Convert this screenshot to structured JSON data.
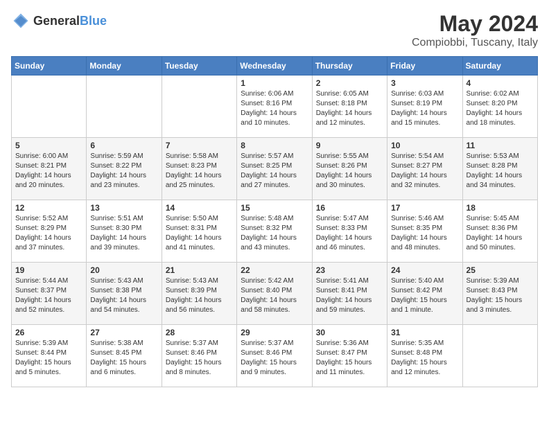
{
  "header": {
    "logo_general": "General",
    "logo_blue": "Blue",
    "month": "May 2024",
    "location": "Compiobbi, Tuscany, Italy"
  },
  "weekdays": [
    "Sunday",
    "Monday",
    "Tuesday",
    "Wednesday",
    "Thursday",
    "Friday",
    "Saturday"
  ],
  "weeks": [
    [
      {
        "day": "",
        "content": ""
      },
      {
        "day": "",
        "content": ""
      },
      {
        "day": "",
        "content": ""
      },
      {
        "day": "1",
        "content": "Sunrise: 6:06 AM\nSunset: 8:16 PM\nDaylight: 14 hours\nand 10 minutes."
      },
      {
        "day": "2",
        "content": "Sunrise: 6:05 AM\nSunset: 8:18 PM\nDaylight: 14 hours\nand 12 minutes."
      },
      {
        "day": "3",
        "content": "Sunrise: 6:03 AM\nSunset: 8:19 PM\nDaylight: 14 hours\nand 15 minutes."
      },
      {
        "day": "4",
        "content": "Sunrise: 6:02 AM\nSunset: 8:20 PM\nDaylight: 14 hours\nand 18 minutes."
      }
    ],
    [
      {
        "day": "5",
        "content": "Sunrise: 6:00 AM\nSunset: 8:21 PM\nDaylight: 14 hours\nand 20 minutes."
      },
      {
        "day": "6",
        "content": "Sunrise: 5:59 AM\nSunset: 8:22 PM\nDaylight: 14 hours\nand 23 minutes."
      },
      {
        "day": "7",
        "content": "Sunrise: 5:58 AM\nSunset: 8:23 PM\nDaylight: 14 hours\nand 25 minutes."
      },
      {
        "day": "8",
        "content": "Sunrise: 5:57 AM\nSunset: 8:25 PM\nDaylight: 14 hours\nand 27 minutes."
      },
      {
        "day": "9",
        "content": "Sunrise: 5:55 AM\nSunset: 8:26 PM\nDaylight: 14 hours\nand 30 minutes."
      },
      {
        "day": "10",
        "content": "Sunrise: 5:54 AM\nSunset: 8:27 PM\nDaylight: 14 hours\nand 32 minutes."
      },
      {
        "day": "11",
        "content": "Sunrise: 5:53 AM\nSunset: 8:28 PM\nDaylight: 14 hours\nand 34 minutes."
      }
    ],
    [
      {
        "day": "12",
        "content": "Sunrise: 5:52 AM\nSunset: 8:29 PM\nDaylight: 14 hours\nand 37 minutes."
      },
      {
        "day": "13",
        "content": "Sunrise: 5:51 AM\nSunset: 8:30 PM\nDaylight: 14 hours\nand 39 minutes."
      },
      {
        "day": "14",
        "content": "Sunrise: 5:50 AM\nSunset: 8:31 PM\nDaylight: 14 hours\nand 41 minutes."
      },
      {
        "day": "15",
        "content": "Sunrise: 5:48 AM\nSunset: 8:32 PM\nDaylight: 14 hours\nand 43 minutes."
      },
      {
        "day": "16",
        "content": "Sunrise: 5:47 AM\nSunset: 8:33 PM\nDaylight: 14 hours\nand 46 minutes."
      },
      {
        "day": "17",
        "content": "Sunrise: 5:46 AM\nSunset: 8:35 PM\nDaylight: 14 hours\nand 48 minutes."
      },
      {
        "day": "18",
        "content": "Sunrise: 5:45 AM\nSunset: 8:36 PM\nDaylight: 14 hours\nand 50 minutes."
      }
    ],
    [
      {
        "day": "19",
        "content": "Sunrise: 5:44 AM\nSunset: 8:37 PM\nDaylight: 14 hours\nand 52 minutes."
      },
      {
        "day": "20",
        "content": "Sunrise: 5:43 AM\nSunset: 8:38 PM\nDaylight: 14 hours\nand 54 minutes."
      },
      {
        "day": "21",
        "content": "Sunrise: 5:43 AM\nSunset: 8:39 PM\nDaylight: 14 hours\nand 56 minutes."
      },
      {
        "day": "22",
        "content": "Sunrise: 5:42 AM\nSunset: 8:40 PM\nDaylight: 14 hours\nand 58 minutes."
      },
      {
        "day": "23",
        "content": "Sunrise: 5:41 AM\nSunset: 8:41 PM\nDaylight: 14 hours\nand 59 minutes."
      },
      {
        "day": "24",
        "content": "Sunrise: 5:40 AM\nSunset: 8:42 PM\nDaylight: 15 hours\nand 1 minute."
      },
      {
        "day": "25",
        "content": "Sunrise: 5:39 AM\nSunset: 8:43 PM\nDaylight: 15 hours\nand 3 minutes."
      }
    ],
    [
      {
        "day": "26",
        "content": "Sunrise: 5:39 AM\nSunset: 8:44 PM\nDaylight: 15 hours\nand 5 minutes."
      },
      {
        "day": "27",
        "content": "Sunrise: 5:38 AM\nSunset: 8:45 PM\nDaylight: 15 hours\nand 6 minutes."
      },
      {
        "day": "28",
        "content": "Sunrise: 5:37 AM\nSunset: 8:46 PM\nDaylight: 15 hours\nand 8 minutes."
      },
      {
        "day": "29",
        "content": "Sunrise: 5:37 AM\nSunset: 8:46 PM\nDaylight: 15 hours\nand 9 minutes."
      },
      {
        "day": "30",
        "content": "Sunrise: 5:36 AM\nSunset: 8:47 PM\nDaylight: 15 hours\nand 11 minutes."
      },
      {
        "day": "31",
        "content": "Sunrise: 5:35 AM\nSunset: 8:48 PM\nDaylight: 15 hours\nand 12 minutes."
      },
      {
        "day": "",
        "content": ""
      }
    ]
  ]
}
